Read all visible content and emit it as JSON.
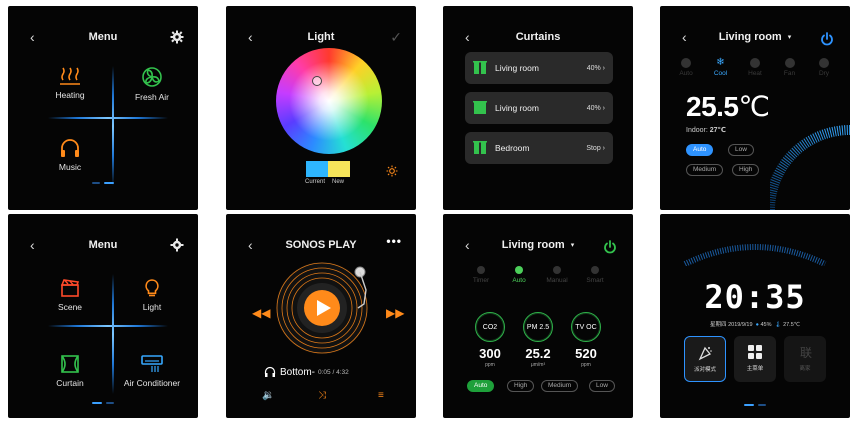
{
  "panel1": {
    "title": "Menu",
    "items": [
      {
        "label": "Heating",
        "icon": "heating-icon"
      },
      {
        "label": "Fresh Air",
        "icon": "fresh-air-icon"
      },
      {
        "label": "Music",
        "icon": "headphones-icon"
      }
    ],
    "accent": "#ff8a1a",
    "green": "#33c24d"
  },
  "panel2": {
    "title": "Light",
    "swatch_current_label": "Current",
    "swatch_new_label": "New",
    "swatch_current_color": "#2eb6ff",
    "swatch_new_color": "#f6e55a"
  },
  "panel3": {
    "title": "Curtains",
    "rows": [
      {
        "label": "Living room",
        "value": "40%"
      },
      {
        "label": "Living room",
        "value": "40%"
      },
      {
        "label": "Bedroom",
        "value": "Stop"
      }
    ]
  },
  "panel4": {
    "title": "Living room",
    "modes": [
      {
        "label": "Auto",
        "on": false
      },
      {
        "label": "Cool",
        "on": true
      },
      {
        "label": "Heat",
        "on": false
      },
      {
        "label": "Fan",
        "on": false
      },
      {
        "label": "Dry",
        "on": false
      }
    ],
    "temperature": "25.5",
    "unit": "℃",
    "indoor_label": "Indoor:",
    "indoor_value": "27℃",
    "fan_speeds": [
      "Auto",
      "Low",
      "Medium",
      "High"
    ],
    "active_speed": "Auto"
  },
  "panel5": {
    "title": "Menu",
    "items": [
      {
        "label": "Scene",
        "icon": "scene-icon"
      },
      {
        "label": "Light",
        "icon": "bulb-icon"
      },
      {
        "label": "Curtain",
        "icon": "curtain-icon"
      },
      {
        "label": "Air Conditioner",
        "icon": "air-conditioner-icon"
      }
    ]
  },
  "panel6": {
    "title": "SONOS PLAY",
    "more": "•••",
    "track": "Bottom-",
    "time": "0:05 / 4:32"
  },
  "panel7": {
    "title": "Living room",
    "modes": [
      {
        "label": "Timer",
        "on": false
      },
      {
        "label": "Auto",
        "on": true
      },
      {
        "label": "Manual",
        "on": false
      },
      {
        "label": "Smart",
        "on": false
      }
    ],
    "sensors": [
      {
        "name": "CO2",
        "value": "300",
        "unit": "ppm"
      },
      {
        "name": "PM 2.5",
        "value": "25.2",
        "unit": "μm/m³"
      },
      {
        "name": "TV OC",
        "value": "520",
        "unit": "ppm"
      }
    ],
    "speeds": [
      "Auto",
      "High",
      "Medium",
      "Low"
    ],
    "active_speed": "Auto"
  },
  "panel8": {
    "time": "20:35",
    "date": "星期四 2019/9/19",
    "humidity": "45%",
    "temperature": "27.5℃",
    "tiles": [
      {
        "label": "派对模式"
      },
      {
        "label": "主菜单"
      },
      {
        "label": "离家"
      }
    ]
  }
}
